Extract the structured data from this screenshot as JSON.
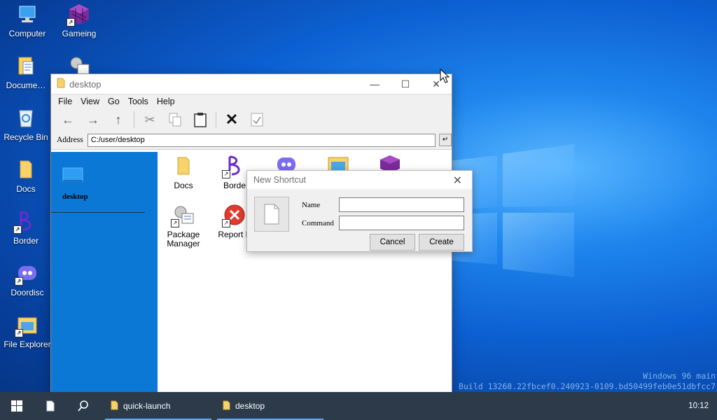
{
  "desktop": {
    "icons": [
      {
        "label": "Computer",
        "icon": "computer-icon"
      },
      {
        "label": "Gameing",
        "icon": "purple-cube-icon"
      },
      {
        "label": "Docume…",
        "icon": "document-icon"
      },
      {
        "label": "Recycle Bin",
        "icon": "recycle-bin-icon"
      },
      {
        "label": "Docs",
        "icon": "folder-icon"
      },
      {
        "label": "Border",
        "icon": "border-app-icon"
      },
      {
        "label": "Doordisc",
        "icon": "discord-icon"
      },
      {
        "label": "File Explorer",
        "icon": "file-explorer-icon"
      }
    ]
  },
  "window": {
    "title": "desktop",
    "menu": [
      "File",
      "View",
      "Go",
      "Tools",
      "Help"
    ],
    "toolbar": [
      "back-icon",
      "forward-icon",
      "up-icon",
      "cut-icon",
      "copy-icon",
      "paste-icon",
      "delete-icon",
      "properties-icon"
    ],
    "address_label": "Address",
    "address_value": "C:/user/desktop",
    "sidebar_title": "desktop",
    "files": [
      {
        "label": "Docs",
        "icon": "folder-icon"
      },
      {
        "label": "Borde",
        "icon": "border-app-icon"
      },
      {
        "label": "Package Manager",
        "icon": "package-manager-icon"
      },
      {
        "label": "Report B",
        "icon": "error-icon"
      }
    ]
  },
  "dialog": {
    "title": "New Shortcut",
    "name_label": "Name",
    "command_label": "Command",
    "name_value": "",
    "command_value": "",
    "cancel_label": "Cancel",
    "create_label": "Create"
  },
  "taskbar": {
    "items": [
      {
        "label": "quick-launch"
      },
      {
        "label": "desktop"
      }
    ],
    "clock": "10:12"
  },
  "watermark": {
    "line1": "Windows 96 main",
    "line2": "Build 13268.22fbcef0.240923-0109.bd50499feb0e51dbfcc7"
  },
  "colors": {
    "accent": "#0b78d6",
    "taskbar": "#2c3a4a"
  }
}
